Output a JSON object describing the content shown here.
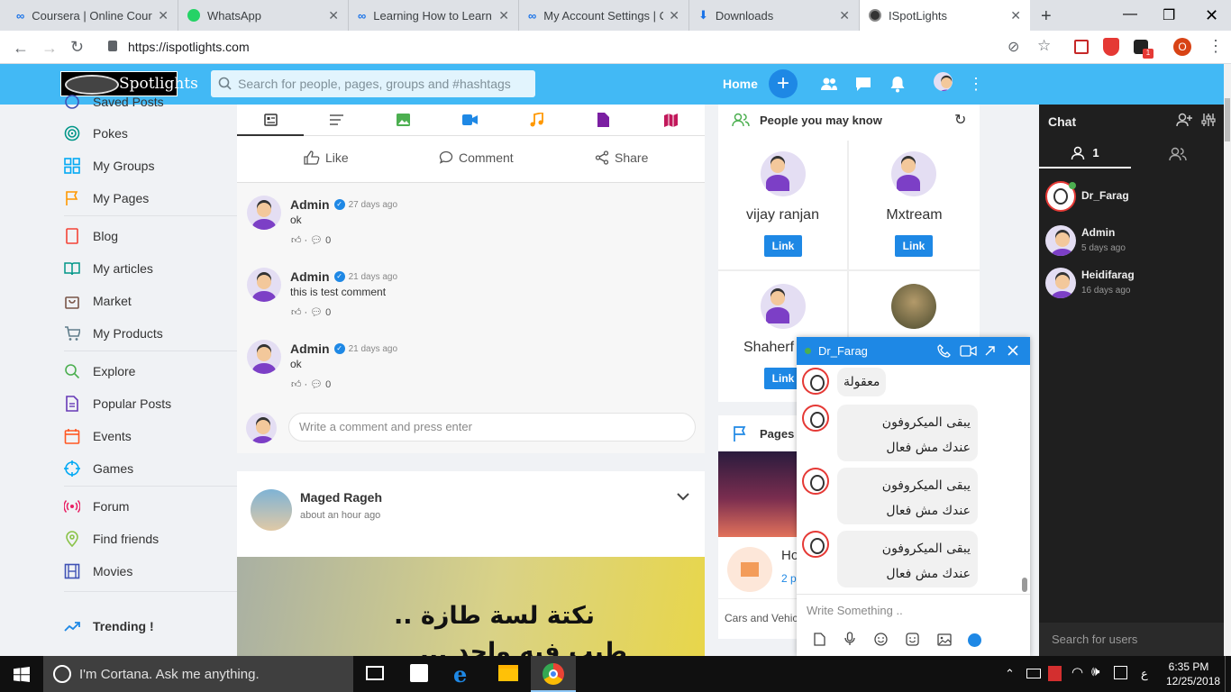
{
  "browser": {
    "tabs": [
      {
        "title": "Coursera | Online Courses"
      },
      {
        "title": "WhatsApp"
      },
      {
        "title": "Learning How to Learn"
      },
      {
        "title": "My Account Settings | C"
      },
      {
        "title": "Downloads"
      },
      {
        "title": "ISpotLights"
      }
    ],
    "url": "https://ispotlights.com",
    "profile_initial": "O",
    "ext_badge": "1"
  },
  "header": {
    "logo_text": "Spotlights",
    "search_placeholder": "Search for people, pages, groups and #hashtags",
    "home_label": "Home"
  },
  "sidebar": {
    "items": [
      {
        "label": "Saved Posts",
        "icon": "bookmark-icon"
      },
      {
        "label": "Pokes",
        "icon": "target-icon"
      },
      {
        "label": "My Groups",
        "icon": "grid-icon"
      },
      {
        "label": "My Pages",
        "icon": "flag-icon"
      },
      {
        "label": "Blog",
        "icon": "book-icon"
      },
      {
        "label": "My articles",
        "icon": "open-book-icon"
      },
      {
        "label": "Market",
        "icon": "bag-icon"
      },
      {
        "label": "My Products",
        "icon": "cart-icon"
      },
      {
        "label": "Explore",
        "icon": "search-icon"
      },
      {
        "label": "Popular Posts",
        "icon": "document-icon"
      },
      {
        "label": "Events",
        "icon": "calendar-icon"
      },
      {
        "label": "Games",
        "icon": "crosshair-icon"
      },
      {
        "label": "Forum",
        "icon": "broadcast-icon"
      },
      {
        "label": "Find friends",
        "icon": "location-icon"
      },
      {
        "label": "Movies",
        "icon": "film-icon"
      }
    ],
    "trending_label": "Trending !"
  },
  "post_actions": {
    "like": "Like",
    "comment": "Comment",
    "share": "Share"
  },
  "comments": [
    {
      "name": "Admin",
      "time": "27 days ago",
      "text": "ok",
      "count": "0"
    },
    {
      "name": "Admin",
      "time": "21 days ago",
      "text": "this is test comment",
      "count": "0"
    },
    {
      "name": "Admin",
      "time": "21 days ago",
      "text": "ok",
      "count": "0"
    }
  ],
  "comment_input_placeholder": "Write a comment and press enter",
  "post2": {
    "author": "Maged Rageh",
    "time": "about an hour ago",
    "image_text_line1": "نكتة لسة طازة ..",
    "image_text_line2": "طيب فيه واحد ..."
  },
  "people": {
    "title": "People you may know",
    "items": [
      {
        "name": "vijay ranjan",
        "button": "Link"
      },
      {
        "name": "Mxtream",
        "button": "Link"
      },
      {
        "name": "Shaherf",
        "button": "Link"
      }
    ]
  },
  "pages_widget": {
    "title": "Pages",
    "page_name": "Ho",
    "page_sub": "2 p",
    "category": "Cars and Vehic"
  },
  "chat": {
    "title": "Chat",
    "online_count": "1",
    "users": [
      {
        "name": "Dr_Farag",
        "time": ""
      },
      {
        "name": "Admin",
        "time": "5 days ago"
      },
      {
        "name": "Heidifarag",
        "time": "16 days ago"
      }
    ],
    "search_placeholder": "Search for users"
  },
  "chat_popup": {
    "user": "Dr_Farag",
    "messages": [
      {
        "line1": "معقولة",
        "line2": ""
      },
      {
        "line1": "يبقى الميكروفون",
        "line2": "عندك مش فعال"
      },
      {
        "line1": "يبقى الميكروفون",
        "line2": "عندك مش فعال"
      },
      {
        "line1": "يبقى الميكروفون",
        "line2": "عندك مش فعال"
      }
    ],
    "input_placeholder": "Write Something .."
  },
  "taskbar": {
    "cortana": "I'm Cortana. Ask me anything.",
    "time": "6:35 PM",
    "date": "12/25/2018",
    "lang": "ع"
  },
  "colors": {
    "header": "#42b9f5",
    "accent": "#1e88e5",
    "chat_bg": "#1f1f1f"
  }
}
